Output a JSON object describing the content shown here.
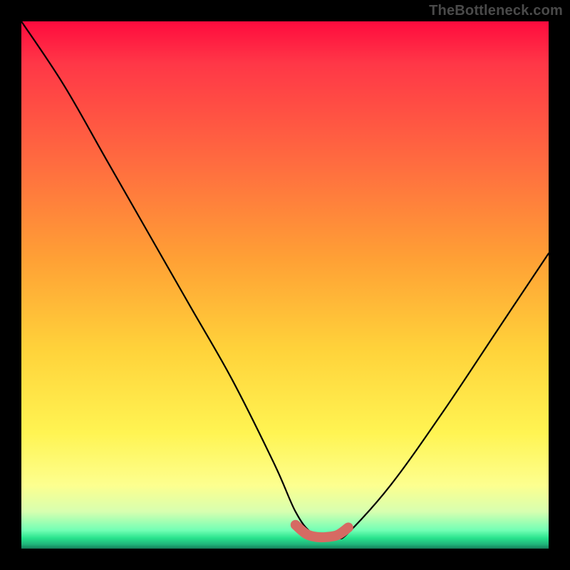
{
  "watermark": "TheBottleneck.com",
  "chart_data": {
    "type": "line",
    "title": "",
    "xlabel": "",
    "ylabel": "",
    "xlim": [
      0,
      100
    ],
    "ylim": [
      0,
      100
    ],
    "series": [
      {
        "name": "bottleneck-curve",
        "x": [
          0,
          8,
          16,
          24,
          32,
          40,
          48,
          52,
          55,
          58,
          60,
          62,
          70,
          80,
          90,
          100
        ],
        "values": [
          100,
          88,
          74,
          60,
          46,
          32,
          16,
          7,
          3,
          2,
          2,
          3,
          12,
          26,
          41,
          56
        ]
      }
    ],
    "highlight": {
      "name": "optimal-range",
      "x": [
        52,
        54,
        56,
        58,
        60,
        62
      ],
      "values": [
        4.5,
        2.8,
        2.2,
        2.2,
        2.6,
        4.0
      ]
    },
    "gradient_stops": [
      {
        "pct": 0,
        "color": "#ff0b3e"
      },
      {
        "pct": 8,
        "color": "#ff3747"
      },
      {
        "pct": 28,
        "color": "#ff6f3f"
      },
      {
        "pct": 45,
        "color": "#ffa035"
      },
      {
        "pct": 62,
        "color": "#ffd23a"
      },
      {
        "pct": 78,
        "color": "#fff452"
      },
      {
        "pct": 88,
        "color": "#fdff8f"
      },
      {
        "pct": 93,
        "color": "#d7ffb0"
      },
      {
        "pct": 96.5,
        "color": "#73ffb5"
      },
      {
        "pct": 98,
        "color": "#29e38d"
      },
      {
        "pct": 99.2,
        "color": "#1fb47a"
      },
      {
        "pct": 100,
        "color": "#157d59"
      }
    ]
  }
}
